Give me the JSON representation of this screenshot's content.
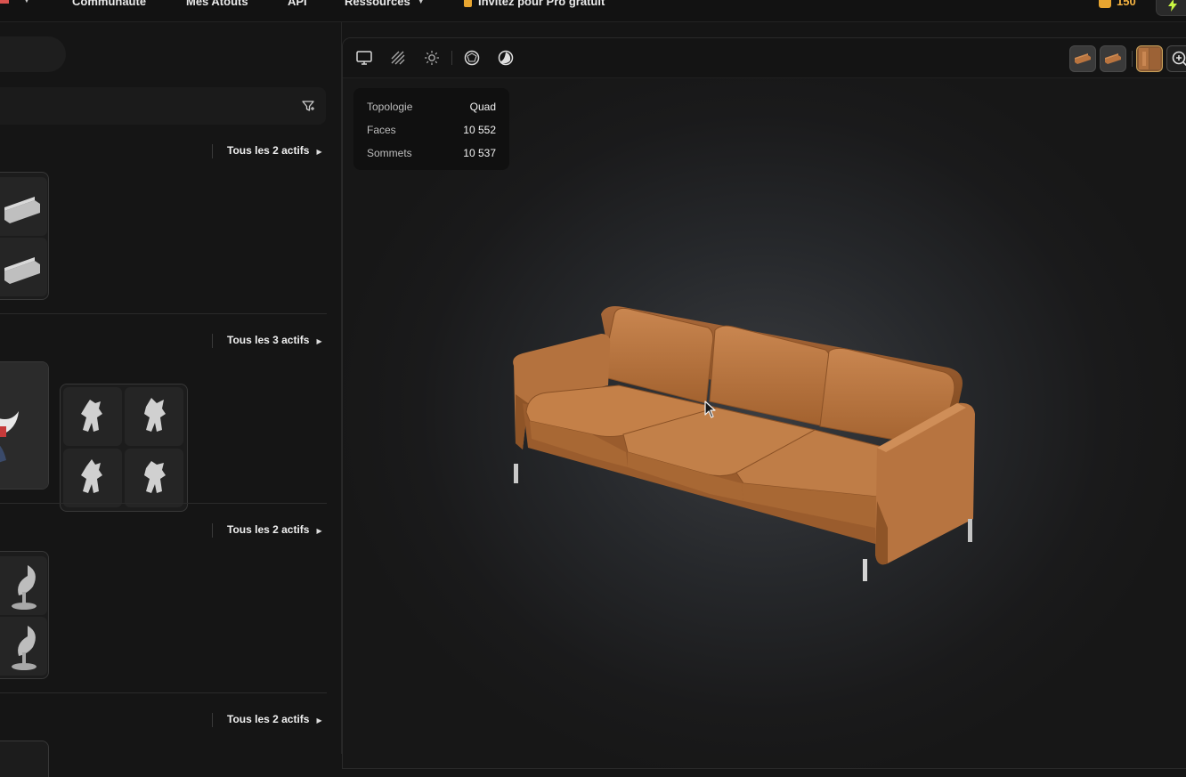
{
  "nav": {
    "items": [
      {
        "label": "Communauté"
      },
      {
        "label": "Mes Atouts"
      },
      {
        "label": "API"
      },
      {
        "label": "Ressources"
      },
      {
        "label": "Invitez pour Pro gratuit"
      }
    ],
    "credits": "150"
  },
  "groups": [
    {
      "link": "Tous les 2 actifs"
    },
    {
      "link": "Tous les 3 actifs"
    },
    {
      "link": "Tous les 2 actifs"
    },
    {
      "link": "Tous les 2 actifs"
    }
  ],
  "viewer": {
    "stats": [
      {
        "label": "Topologie",
        "value": "Quad"
      },
      {
        "label": "Faces",
        "value": "10 552"
      },
      {
        "label": "Sommets",
        "value": "10 537"
      }
    ]
  },
  "icons": {
    "toolbar": [
      "monitor-icon",
      "wireframe-icon",
      "light-icon",
      "material-icon",
      "sphere-icon"
    ],
    "filter": "filter-icon",
    "zoom": "zoom-icon"
  },
  "colors": {
    "accent_credits": "#f5b342",
    "bolt": "#c8f542",
    "sofa_leather": "#b9743f"
  }
}
